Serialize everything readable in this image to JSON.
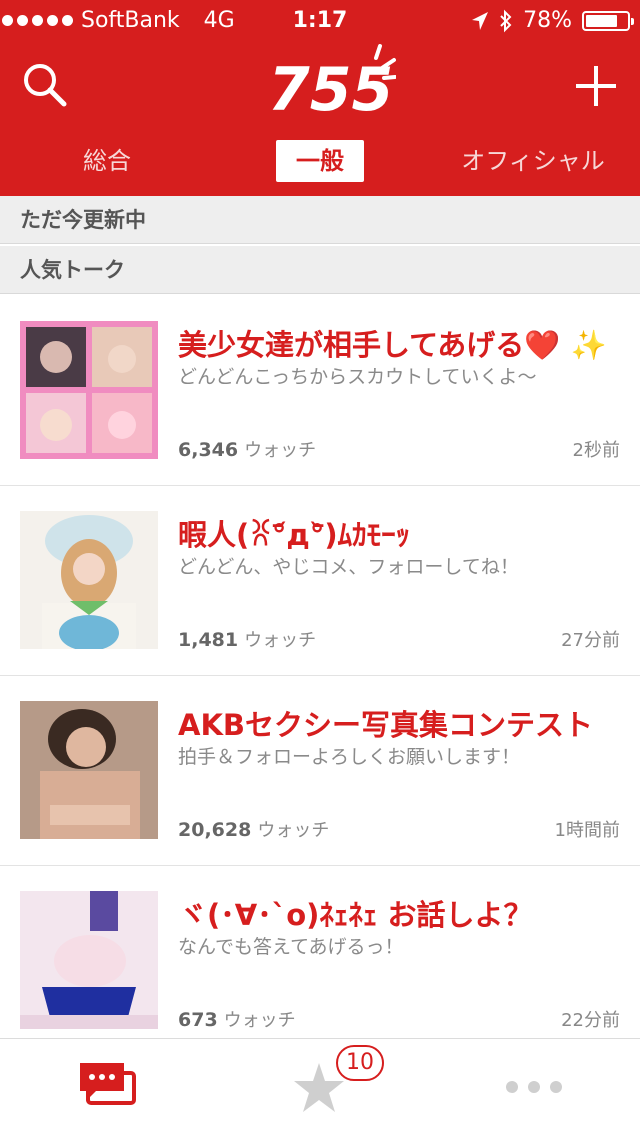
{
  "status_bar": {
    "carrier": "SoftBank",
    "network": "4G",
    "time": "1:17",
    "battery": "78%",
    "battery_level": 0.78
  },
  "header": {
    "logo_text": "755",
    "tabs": [
      {
        "label": "総合",
        "active": false
      },
      {
        "label": "一般",
        "active": true
      },
      {
        "label": "オフィシャル",
        "active": false
      }
    ]
  },
  "sections": {
    "recent": "ただ今更新中",
    "popular": "人気トーク"
  },
  "talks": [
    {
      "title": "美少女達が相手してあげる❤️ ✨",
      "description": "どんどんこっちからスカウトしていくよ〜",
      "watch_count": "6,346",
      "watch_label": "ウォッチ",
      "updated": "2秒前"
    },
    {
      "title": "暇人(ꐦ°᷄д°᷅)ﾑｶﾓｰｯ",
      "description": "どんどん、やじコメ、フォローしてね！",
      "watch_count": "1,481",
      "watch_label": "ウォッチ",
      "updated": "27分前"
    },
    {
      "title": "AKBセクシー写真集コンテスト",
      "description": "拍手＆フォローよろしくお願いします！",
      "watch_count": "20,628",
      "watch_label": "ウォッチ",
      "updated": "1時間前"
    },
    {
      "title": "ヾ(･∀･`o)ﾈｪﾈｪ お話しよ？",
      "description": "なんでも答えてあげるっ！",
      "watch_count": "673",
      "watch_label": "ウォッチ",
      "updated": "22分前"
    }
  ],
  "tab_bar": {
    "items": [
      {
        "icon": "chat-bubbles-icon",
        "active": true
      },
      {
        "icon": "star-icon",
        "active": false
      },
      {
        "icon": "more-dots-icon",
        "active": false
      }
    ],
    "badge": "10"
  },
  "colors": {
    "brand_red": "#d61e1e",
    "section_bg": "#eeeeee",
    "muted_text": "#8a8a8a"
  }
}
